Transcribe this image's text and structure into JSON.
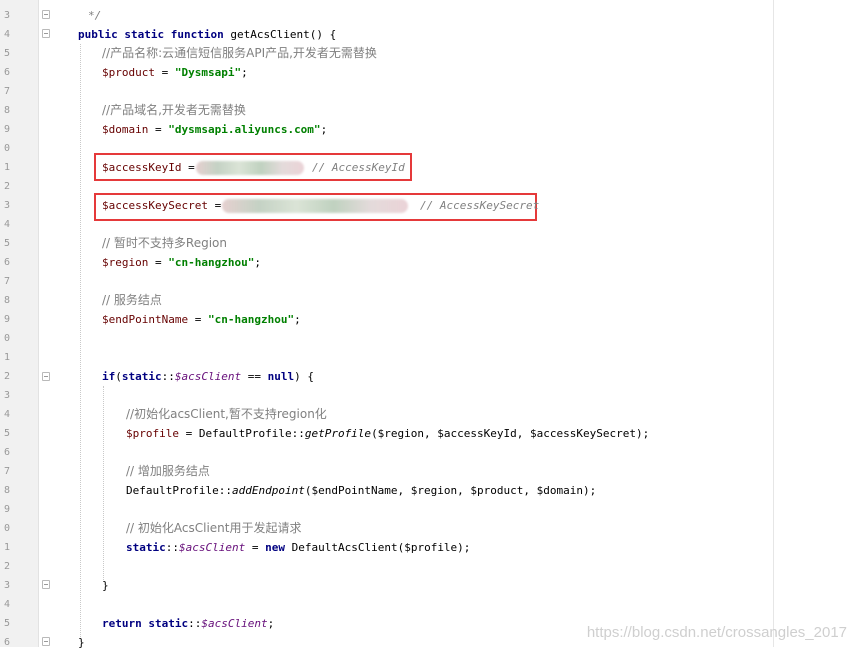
{
  "line_numbers": [
    "3",
    "4",
    "5",
    "6",
    "7",
    "8",
    "9",
    "0",
    "1",
    "2",
    "3",
    "4",
    "5",
    "6",
    "7",
    "8",
    "9",
    "0",
    "1",
    "2",
    "3",
    "4",
    "5",
    "6",
    "7",
    "8",
    "9",
    "0",
    "1",
    "2",
    "3",
    "4",
    "5",
    "6"
  ],
  "code": {
    "doc_end": "*/",
    "sig_kw": "public static function",
    "sig_name": " getAcsClient() {",
    "c_product": "//产品名称:云通信短信服务API产品,开发者无需替换",
    "v_product": "$product",
    "s_product": "\"Dysmsapi\"",
    "c_domain": "//产品域名,开发者无需替换",
    "v_domain": "$domain",
    "s_domain": "\"dysmsapi.aliyuncs.com\"",
    "v_key_id": "$accessKeyId",
    "c_key_id": "// AccessKeyId",
    "v_key_secret": "$accessKeySecret",
    "c_key_secret": "// AccessKeySecret",
    "c_region": "// 暂时不支持多Region",
    "v_region": "$region",
    "s_region": "\"cn-hangzhou\"",
    "c_endpoint": "// 服务结点",
    "v_endpoint": "$endPointName",
    "s_endpoint": "\"cn-hangzhou\"",
    "if_kw": "if",
    "static_kw": "static",
    "acs_client": "$acsClient",
    "null_kw": "null",
    "c_init_profile": "//初始化acsClient,暂不支持region化",
    "v_profile": "$profile",
    "profile_class": "DefaultProfile",
    "get_profile_fn": "getProfile",
    "profile_args": "($region, $accessKeyId, $accessKeySecret);",
    "c_add_endpoint": "// 增加服务结点",
    "add_endpoint_fn": "addEndpoint",
    "endpoint_args": "($endPointName, $region, $product, $domain);",
    "c_init_client": "// 初始化AcsClient用于发起请求",
    "new_kw": "new",
    "client_class": "DefaultAcsClient",
    "client_args": "($profile);",
    "close_brace": "}",
    "return_kw": "return",
    "op_assign": " = ",
    "op_eq": " == ",
    "op_scope": "::",
    "semicolon": ";",
    "paren_open": "(",
    "if_tail": ") {"
  },
  "watermark": "https://blog.csdn.net/crossangles_2017",
  "colors": {
    "keyword": "#000080",
    "string": "#008000",
    "comment": "#808080",
    "highlight_box": "#e5393a"
  }
}
